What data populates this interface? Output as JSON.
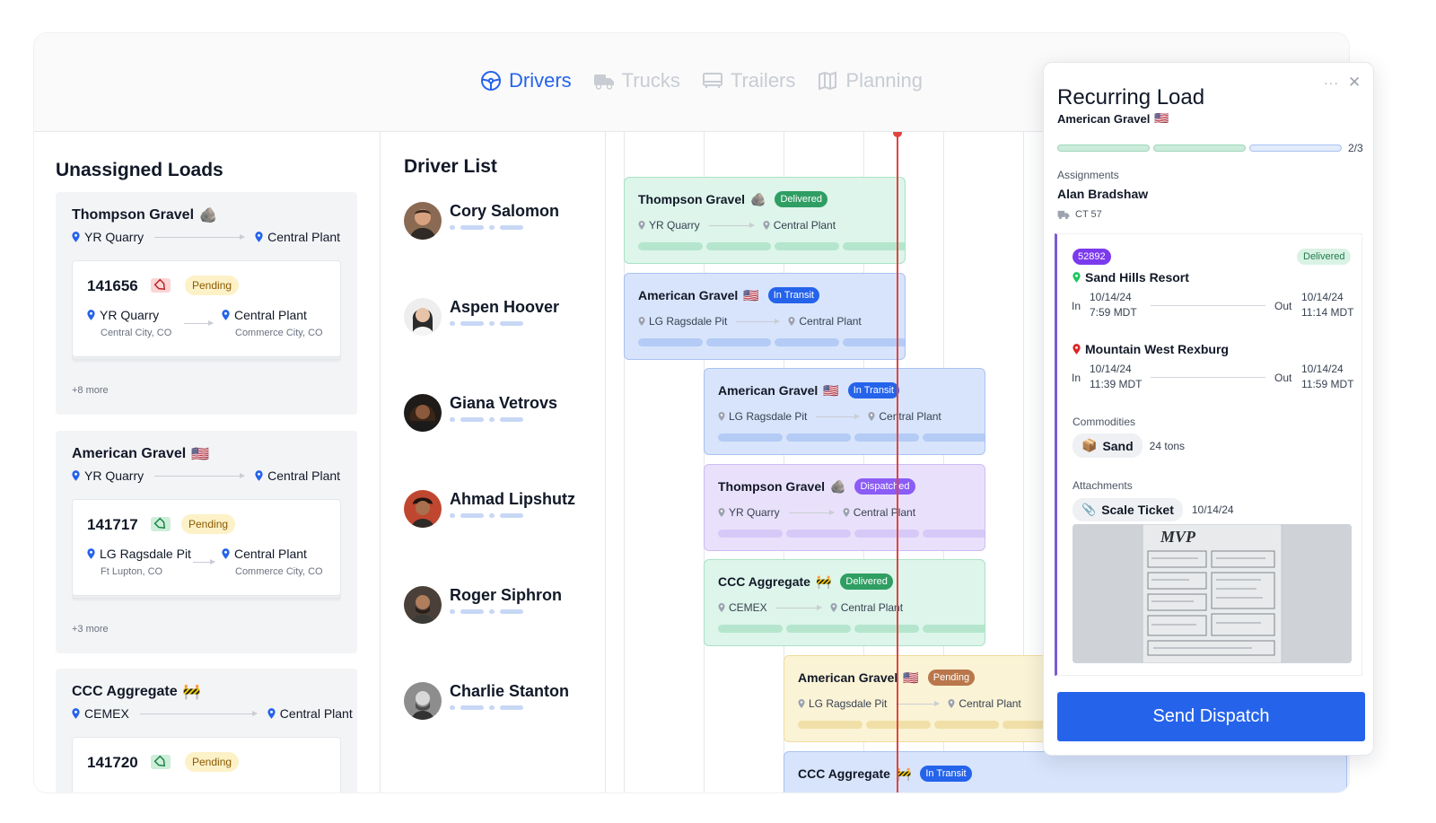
{
  "tabs": [
    {
      "label": "Drivers",
      "active": true
    },
    {
      "label": "Trucks",
      "active": false
    },
    {
      "label": "Trailers",
      "active": false
    },
    {
      "label": "Planning",
      "active": false
    }
  ],
  "unassigned": {
    "title": "Unassigned Loads",
    "groups": [
      {
        "company": "Thompson Gravel",
        "emoji": "🪨",
        "from": "YR Quarry",
        "to": "Central Plant",
        "card": {
          "number": "141656",
          "status": "Pending",
          "from": "YR Quarry",
          "from_city": "Central City, CO",
          "to": "Central Plant",
          "to_city": "Commerce City, CO"
        },
        "more": "+8 more"
      },
      {
        "company": "American Gravel",
        "emoji": "🇺🇸",
        "from": "YR Quarry",
        "to": "Central Plant",
        "card": {
          "number": "141717",
          "status": "Pending",
          "from": "LG Ragsdale Pit",
          "from_city": "Ft Lupton, CO",
          "to": "Central Plant",
          "to_city": "Commerce City, CO"
        },
        "more": "+3 more"
      },
      {
        "company": "CCC Aggregate",
        "emoji": "🚧",
        "from": "CEMEX",
        "to": "Central Plant",
        "card": {
          "number": "141720",
          "status": "Pending"
        }
      }
    ]
  },
  "driver_list": {
    "title": "Driver List",
    "drivers": [
      {
        "name": "Cory Salomon"
      },
      {
        "name": "Aspen Hoover"
      },
      {
        "name": "Giana Vetrovs"
      },
      {
        "name": "Ahmad Lipshutz"
      },
      {
        "name": "Roger Siphron"
      },
      {
        "name": "Charlie Stanton"
      }
    ]
  },
  "timeline": {
    "blocks": [
      {
        "company": "Thompson Gravel",
        "emoji": "🪨",
        "status": "Delivered",
        "from": "YR Quarry",
        "to": "Central Plant",
        "theme": "green"
      },
      {
        "company": "American Gravel",
        "emoji": "🇺🇸",
        "status": "In Transit",
        "from": "LG Ragsdale Pit",
        "to": "Central Plant",
        "theme": "blue"
      },
      {
        "company": "American Gravel",
        "emoji": "🇺🇸",
        "status": "In Transit",
        "from": "LG Ragsdale Pit",
        "to": "Central Plant",
        "theme": "blue"
      },
      {
        "company": "Thompson Gravel",
        "emoji": "🪨",
        "status": "Dispatched",
        "from": "YR Quarry",
        "to": "Central Plant",
        "theme": "purple"
      },
      {
        "company": "CCC Aggregate",
        "emoji": "🚧",
        "status": "Delivered",
        "from": "CEMEX",
        "to": "Central Plant",
        "theme": "green"
      },
      {
        "company": "American Gravel",
        "emoji": "🇺🇸",
        "status": "Pending",
        "from": "LG Ragsdale Pit",
        "to": "Central Plant",
        "theme": "yellow"
      },
      {
        "company": "CCC Aggregate",
        "emoji": "🚧",
        "status": "In Transit",
        "from": "",
        "to": "",
        "theme": "blue"
      }
    ]
  },
  "panel": {
    "title": "Recurring Load",
    "company": "American Gravel",
    "flag": "🇺🇸",
    "progress": {
      "done": 2,
      "total": 3,
      "label": "2/3"
    },
    "assignments_label": "Assignments",
    "driver": "Alan Bradshaw",
    "truck": "CT 57",
    "load_number": "52892",
    "load_status": "Delivered",
    "stops": [
      {
        "name": "Sand Hills Resort",
        "in_label": "In",
        "in_date": "10/14/24",
        "in_time": "7:59 MDT",
        "out_label": "Out",
        "out_date": "10/14/24",
        "out_time": "11:14 MDT",
        "pin_color": "#22c55e"
      },
      {
        "name": "Mountain West Rexburg",
        "in_label": "In",
        "in_date": "10/14/24",
        "in_time": "11:39 MDT",
        "out_label": "Out",
        "out_date": "10/14/24",
        "out_time": "11:59 MDT",
        "pin_color": "#dc2626"
      }
    ],
    "commodities_label": "Commodities",
    "commodity": "Sand",
    "commodity_emoji": "📦",
    "commodity_qty": "24 tons",
    "attachments_label": "Attachments",
    "attachment": "Scale Ticket",
    "attachment_date": "10/14/24",
    "ticket_logo": "MVP",
    "send_label": "Send Dispatch"
  },
  "colors": {
    "accent": "#2563eb",
    "now_line": "#e0453f",
    "delivered": "#2f9e63",
    "in_transit": "#2563eb",
    "dispatched": "#8b5cf6",
    "pending": "#b45309"
  }
}
